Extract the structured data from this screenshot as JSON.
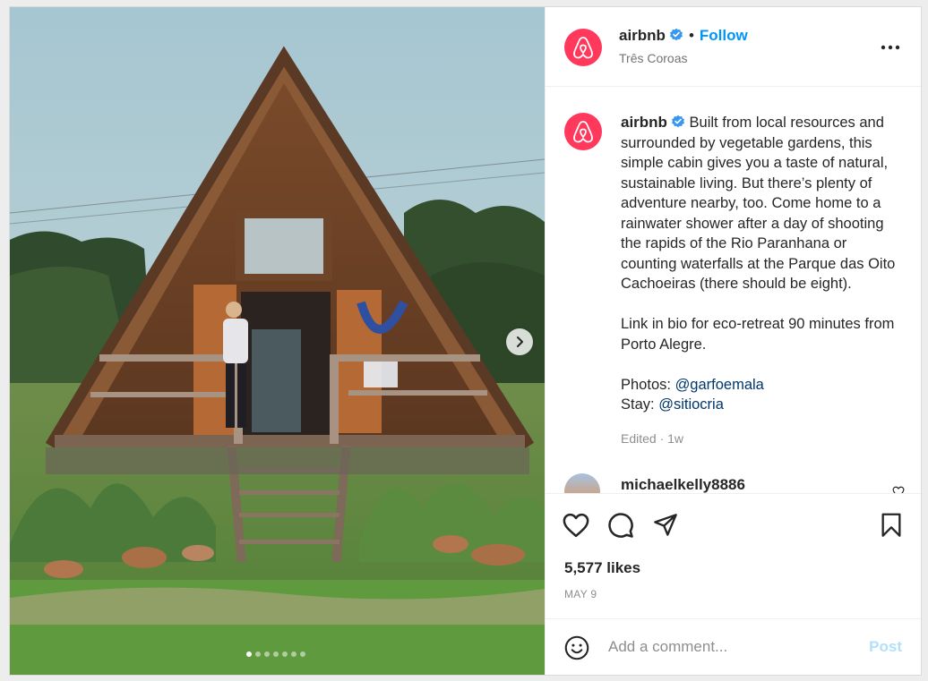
{
  "post": {
    "dots_count": 7,
    "active_dot": 0
  },
  "header": {
    "username": "airbnb",
    "separator": "•",
    "follow_label": "Follow",
    "location": "Três Coroas"
  },
  "caption": {
    "username": "airbnb",
    "paragraph1": "Built from local resources and surrounded by vegetable gardens, this simple cabin gives you a taste of natural, sustainable living. But there’s plenty of adventure nearby, too. Come home to a rainwater shower after a day of shooting the rapids of the Rio Paranhana or counting waterfalls at the Parque das Oito Cachoeiras (there should be eight).",
    "paragraph2": "Link in bio for eco-retreat 90 minutes from Porto Alegre.",
    "photos_label": "Photos:",
    "photos_mention": "@garfoemala",
    "stay_label": "Stay:",
    "stay_mention": "@sitiocria",
    "edited": "Edited · 1w"
  },
  "comments": [
    {
      "username": "michaelkelly8886"
    }
  ],
  "stats": {
    "likes": "5,577 likes",
    "date": "MAY 9"
  },
  "add_comment": {
    "placeholder": "Add a comment...",
    "post_label": "Post"
  },
  "colors": {
    "brand": "#ff385c",
    "link": "#0095f6",
    "verified": "#3897f0",
    "post_disabled": "#b2dffc"
  },
  "icons": [
    "airbnb-logo-icon",
    "verified-badge-icon",
    "more-options-icon",
    "heart-icon",
    "comment-icon",
    "share-icon",
    "bookmark-icon",
    "emoji-icon",
    "chevron-right-icon"
  ]
}
